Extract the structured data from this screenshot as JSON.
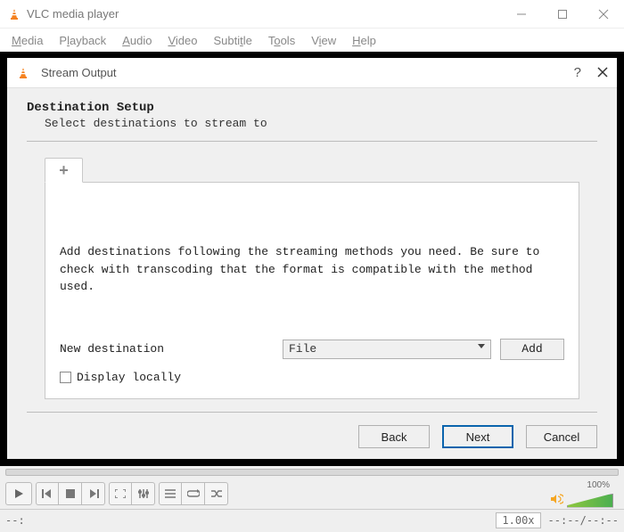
{
  "window": {
    "title": "VLC media player"
  },
  "menu": {
    "items": [
      "Media",
      "Playback",
      "Audio",
      "Video",
      "Subtitle",
      "Tools",
      "View",
      "Help"
    ]
  },
  "dialog": {
    "title": "Stream Output",
    "section_title": "Destination Setup",
    "section_subtitle": "Select destinations to stream to",
    "panel_text": "Add destinations following the streaming methods you need. Be sure to check with transcoding that the format is compatible with the method used.",
    "new_destination_label": "New destination",
    "destination_value": "File",
    "add_label": "Add",
    "display_locally_label": "Display locally",
    "back_label": "Back",
    "next_label": "Next",
    "cancel_label": "Cancel"
  },
  "player": {
    "volume_pct": "100%",
    "speed": "1.00x",
    "time": "--:--/--:--",
    "status_left": "--:"
  }
}
